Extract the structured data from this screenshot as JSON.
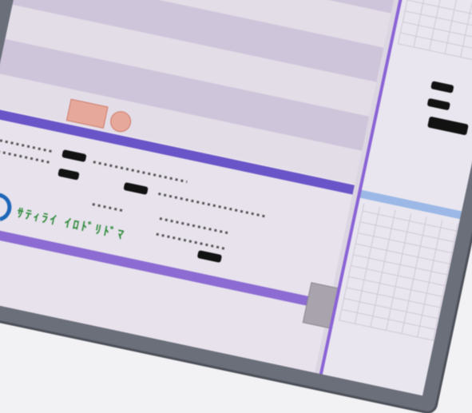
{
  "app": {
    "title": ""
  },
  "logo": {
    "brand_text": "ｻﾃｨﾗｲ ｲﾛﾄﾞﾘﾄﾞﾏ"
  },
  "colors": {
    "accent": "#6a55c8",
    "sidebar_border": "#8a63d6",
    "logo_blue": "#1e66b8",
    "logo_green": "#2d8a3a"
  },
  "icons": {
    "logo_mark": "swirl-logo-icon"
  }
}
